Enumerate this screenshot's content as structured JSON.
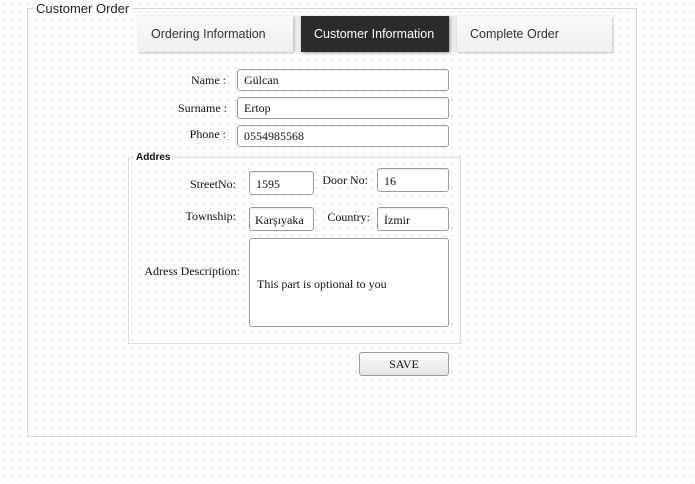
{
  "form": {
    "legend": "Customer Order"
  },
  "tabs": [
    {
      "label": "Ordering Information",
      "active": false
    },
    {
      "label": "Customer Information",
      "active": true
    },
    {
      "label": "Complete Order",
      "active": false
    }
  ],
  "customer": {
    "name_label": "Name :",
    "name_value": "Gülcan",
    "surname_label": "Surname :",
    "surname_value": "Ertop",
    "phone_label": "Phone :",
    "phone_value": "0554985568"
  },
  "address": {
    "legend": "Addres",
    "street_label": "StreetNo:",
    "street_value": "1595",
    "door_label": "Door No:",
    "door_value": "16",
    "township_label": "Township:",
    "township_value": "Karşıyaka",
    "country_label": "Country:",
    "country_value": "İzmir",
    "description_label": "Adress Description:",
    "description_value": "This part is optional to you"
  },
  "actions": {
    "save_label": "SAVE"
  },
  "colors": {
    "active_tab_bg": "#2b2b2b",
    "active_tab_text": "#ffffff",
    "tab_bg": "#f3f3f3"
  }
}
